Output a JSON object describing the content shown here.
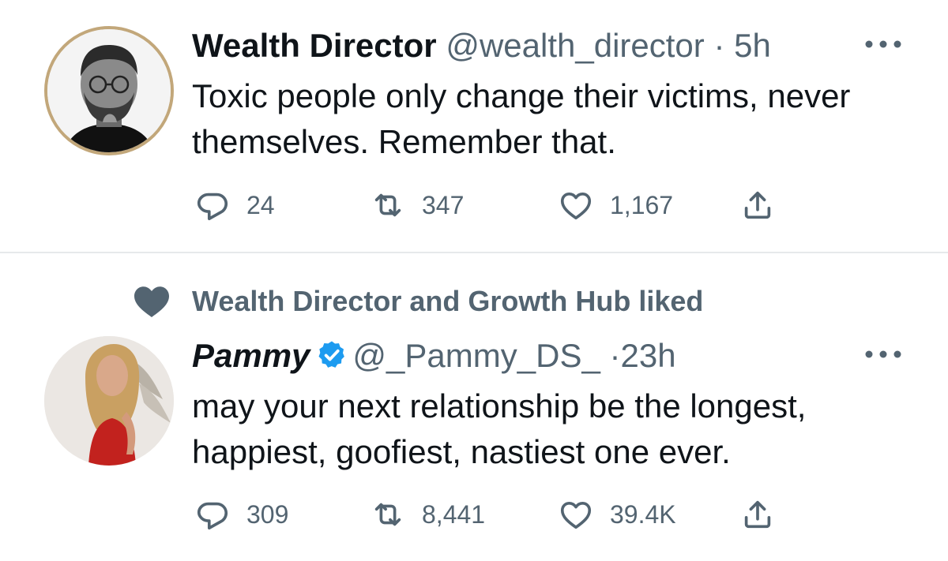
{
  "colors": {
    "text": "#0f1419",
    "secondary": "#536471",
    "verified": "#1d9bf0",
    "divider": "#e6e9eb"
  },
  "tweets": [
    {
      "display_name": "Wealth Director",
      "handle": "@wealth_director",
      "separator": "·",
      "time": "5h",
      "text": "Toxic people only change their victims, never themselves. Remember that.",
      "stats": {
        "replies": "24",
        "retweets": "347",
        "likes": "1,167"
      },
      "avatar_icon": "avatar-portrait-icon"
    },
    {
      "social_context": "Wealth Director and Growth Hub liked",
      "display_name": "Pammy",
      "verified": true,
      "handle": "@_Pammy_DS_",
      "separator": "·",
      "time": "23h",
      "text": "may your next relationship be the longest, happiest, goofiest, nastiest one ever.",
      "stats": {
        "replies": "309",
        "retweets": "8,441",
        "likes": "39.4K"
      },
      "avatar_icon": "avatar-photo-icon"
    }
  ]
}
